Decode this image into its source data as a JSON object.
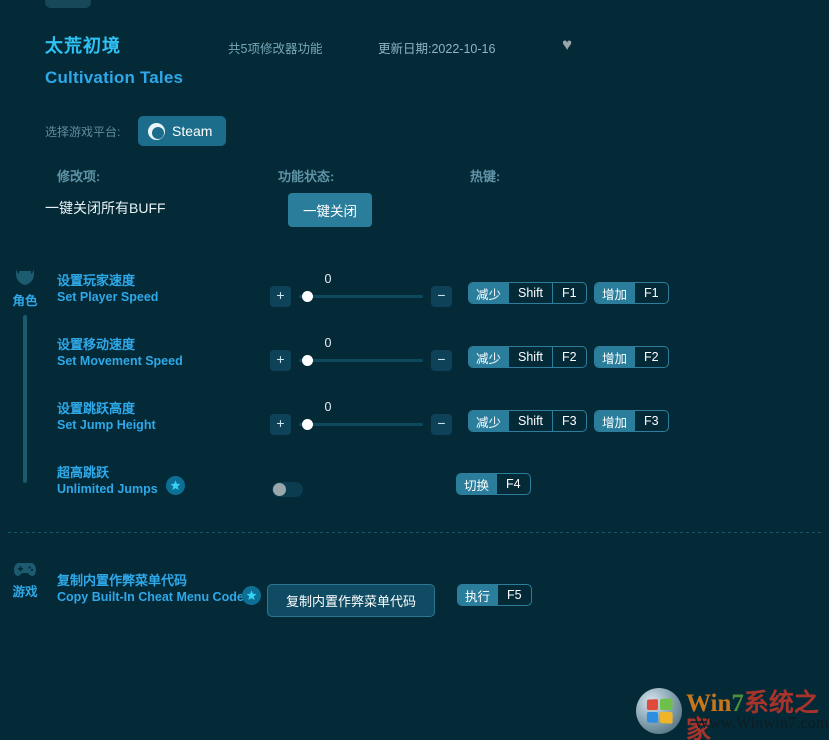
{
  "header": {
    "title_cn": "太荒初境",
    "title_en": "Cultivation Tales",
    "feature_count": "共5项修改器功能",
    "update_date": "更新日期:2022-10-16",
    "favorite_icon": "heart-icon"
  },
  "platform": {
    "label": "选择游戏平台:",
    "selected": "Steam"
  },
  "columns": {
    "option": "修改项:",
    "status": "功能状态:",
    "hotkey": "热键:"
  },
  "onekey": {
    "label": "一键关闭所有BUFF",
    "button": "一键关闭"
  },
  "categories": [
    {
      "name": "角色",
      "icon": "armor-helmet-icon"
    },
    {
      "name": "游戏",
      "icon": "gamepad-icon"
    }
  ],
  "rows": [
    {
      "cn": "设置玩家速度",
      "en": "Set Player Speed",
      "control": "slider",
      "value": "0",
      "plus": "+",
      "minus": "−",
      "hotkeys": [
        {
          "action": "减少",
          "keys": "Shift",
          "key2": "F1"
        },
        {
          "action": "增加",
          "keys": "F1"
        }
      ]
    },
    {
      "cn": "设置移动速度",
      "en": "Set Movement Speed",
      "control": "slider",
      "value": "0",
      "plus": "+",
      "minus": "−",
      "hotkeys": [
        {
          "action": "减少",
          "keys": "Shift",
          "key2": "F2"
        },
        {
          "action": "增加",
          "keys": "F2"
        }
      ]
    },
    {
      "cn": "设置跳跃高度",
      "en": "Set Jump Height",
      "control": "slider",
      "value": "0",
      "plus": "+",
      "minus": "−",
      "hotkeys": [
        {
          "action": "减少",
          "keys": "Shift",
          "key2": "F3"
        },
        {
          "action": "增加",
          "keys": "F3"
        }
      ]
    },
    {
      "cn": "超高跳跃",
      "en": "Unlimited Jumps",
      "control": "toggle",
      "toggle_on": false,
      "starred": true,
      "hotkeys": [
        {
          "action": "切换",
          "keys": "F4"
        }
      ]
    },
    {
      "cn": "复制内置作弊菜单代码",
      "en": "Copy Built-In Cheat Menu Code",
      "control": "button",
      "button_label": "复制内置作弊菜单代码",
      "starred": true,
      "hotkeys": [
        {
          "action": "执行",
          "keys": "F5"
        }
      ]
    }
  ],
  "watermark": {
    "brand_1": "Win",
    "brand_2": "7",
    "brand_3": "系统之家",
    "url": "Www.Winwin7.com"
  },
  "colors": {
    "background": "#042a38",
    "accent": "#2fa8e8",
    "button": "#2a7e9c",
    "muted": "#5e8c9c"
  }
}
